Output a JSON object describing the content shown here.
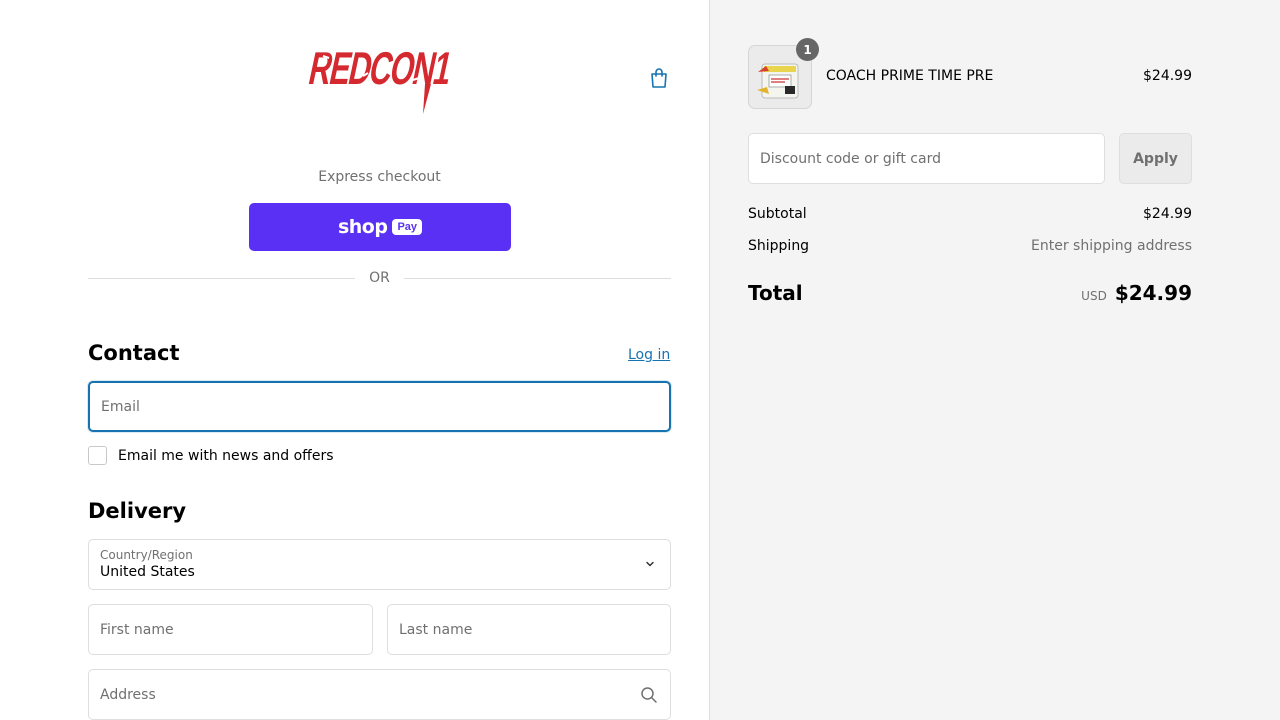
{
  "brand": {
    "logo_text": "REDCON1",
    "logo_color": "#d42a2f"
  },
  "header": {
    "cart_icon": "shopping-bag-icon"
  },
  "express": {
    "label": "Express checkout",
    "shoppay_word": "shop",
    "shoppay_badge": "Pay",
    "shoppay_color": "#5a31f4",
    "divider_text": "OR"
  },
  "contact": {
    "heading": "Contact",
    "login_label": "Log in",
    "email_placeholder": "Email",
    "newsletter_label": "Email me with news and offers",
    "newsletter_checked": false
  },
  "delivery": {
    "heading": "Delivery",
    "country_label": "Country/Region",
    "country_value": "United States",
    "first_name_placeholder": "First name",
    "last_name_placeholder": "Last name",
    "address_placeholder": "Address"
  },
  "order": {
    "item": {
      "quantity": "1",
      "name": "COACH PRIME TIME PRE",
      "price": "$24.99"
    },
    "discount_placeholder": "Discount code or gift card",
    "apply_label": "Apply",
    "subtotal_label": "Subtotal",
    "subtotal_value": "$24.99",
    "shipping_label": "Shipping",
    "shipping_value": "Enter shipping address",
    "total_label": "Total",
    "total_currency": "USD",
    "total_value": "$24.99"
  },
  "colors": {
    "accent": "#1773b0",
    "panel_bg": "#f4f4f4"
  }
}
